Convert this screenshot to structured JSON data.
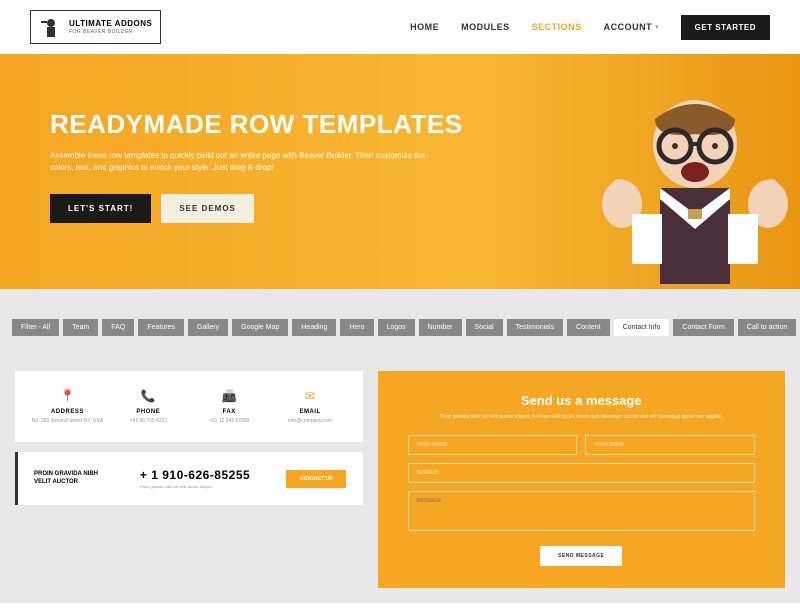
{
  "header": {
    "logo_main": "ULTIMATE ADDONS",
    "logo_sub": "FOR BEAVER BUILDER",
    "nav": {
      "home": "HOME",
      "modules": "MODULES",
      "sections": "SECTIONS",
      "account": "ACCOUNT"
    },
    "get_started": "GET STARTED"
  },
  "hero": {
    "title": "READYMADE ROW TEMPLATES",
    "subtitle": "Assemble these row templates to quickly build out an entire page with Beaver Builder. Then customize the colors, text, and graphics to match your style. Just drag & drop!",
    "btn1": "LET'S START!",
    "btn2": "SEE DEMOS"
  },
  "filters": [
    "Filter - All",
    "Team",
    "FAQ",
    "Features",
    "Gallery",
    "Google Map",
    "Heading",
    "Hero",
    "Logos",
    "Number",
    "Social",
    "Testimonials",
    "Content",
    "Contact Info",
    "Contact Form",
    "Call to action"
  ],
  "active_filter": 13,
  "contact": {
    "items": [
      {
        "icon": "📍",
        "title": "ADDRESS",
        "val": "No. 250 Second Street NY, USA"
      },
      {
        "icon": "📞",
        "title": "PHONE",
        "val": "+91 98 765 4321"
      },
      {
        "icon": "📠",
        "title": "FAX",
        "val": "+91 12 345 67890"
      },
      {
        "icon": "✉",
        "title": "EMAIL",
        "val": "info@company.com"
      }
    ]
  },
  "phone_block": {
    "left": "PROIN GRAVIDA NIBH VELIT AUCTOR",
    "num": "+ 1 910-626-85255",
    "sub": "Proin gravida nibh vel velit auctor aliquet.",
    "btn": "CONTACT US"
  },
  "form": {
    "title": "Send us a message",
    "sub": "Proin gravida nibh vel velit auctor aliquet. Aenean sollicitudin, lorem quis bibendum auctor, nisi elit consequat ipsum nec sagittis.",
    "name_ph": "YOUR NAME",
    "email_ph": "YOUR EMAIL",
    "subject_ph": "SUBJECT",
    "msg_ph": "MESSAGE",
    "send": "SEND MESSAGE"
  }
}
